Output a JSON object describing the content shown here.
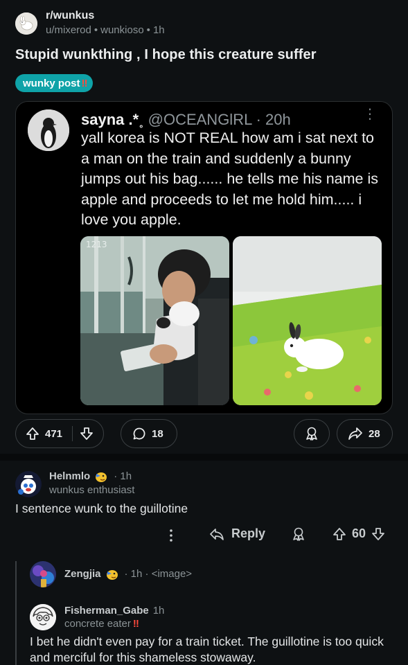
{
  "post": {
    "subreddit": "r/wunkus",
    "author": "u/mixerod",
    "author_flair": "wunkioso",
    "time": "1h",
    "title": "Stupid wunkthing , I hope this creature suffer",
    "flair": "wunky post",
    "flair_bang": "‼",
    "flair_color": "#0fa3a8"
  },
  "tweet": {
    "name": "sayna .*˳",
    "handle": "@OCEANGlRL · 20h",
    "text": "yall korea is NOT REAL how am i sat next to a man on the train and suddenly a bunny jumps out his bag...... he tells me his name is apple and proceeds to let me hold him..... i love you apple.",
    "image_left_label": "1213"
  },
  "actions": {
    "upvotes": "471",
    "comments": "18",
    "shares": "28"
  },
  "comments": [
    {
      "author": "Helnmlo",
      "time": "· 1h",
      "flair": "wunkus enthusiast",
      "text": "I sentence wunk to the guillotine",
      "reply_label": "Reply",
      "votes": "60"
    },
    {
      "author": "Zengjia",
      "meta": "· 1h · <image>"
    },
    {
      "author": "Fisherman_Gabe",
      "time": "1h",
      "flair": "concrete eater",
      "flair_bang": "‼",
      "text": "I bet he didn't even pay for a train ticket. The guillotine is too quick and merciful for this shameless stowaway."
    }
  ]
}
